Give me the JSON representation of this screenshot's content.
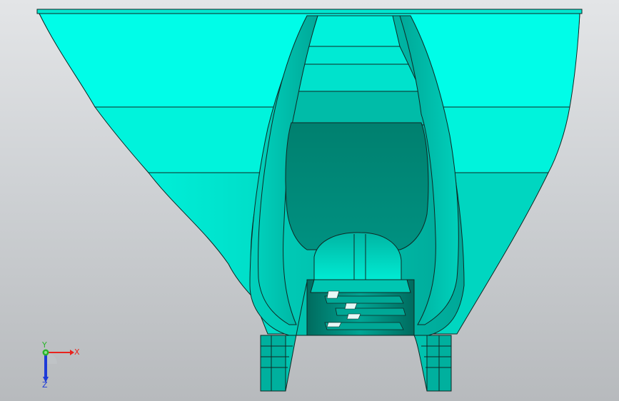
{
  "viewport": {
    "background_top": "#e3e5e7",
    "background_bottom": "#b7babd"
  },
  "model": {
    "description_icon": "3d-part-shaded-with-edges",
    "color_light": "#00ffe6",
    "color_mid": "#00c8b4",
    "color_dark": "#008a7a",
    "edge_color": "#102824"
  },
  "triad": {
    "x_label": "X",
    "y_label": "Y",
    "z_label": "Z",
    "x_color": "#e8231d",
    "y_color": "#2bb52b",
    "z_color": "#1e3bd8"
  }
}
